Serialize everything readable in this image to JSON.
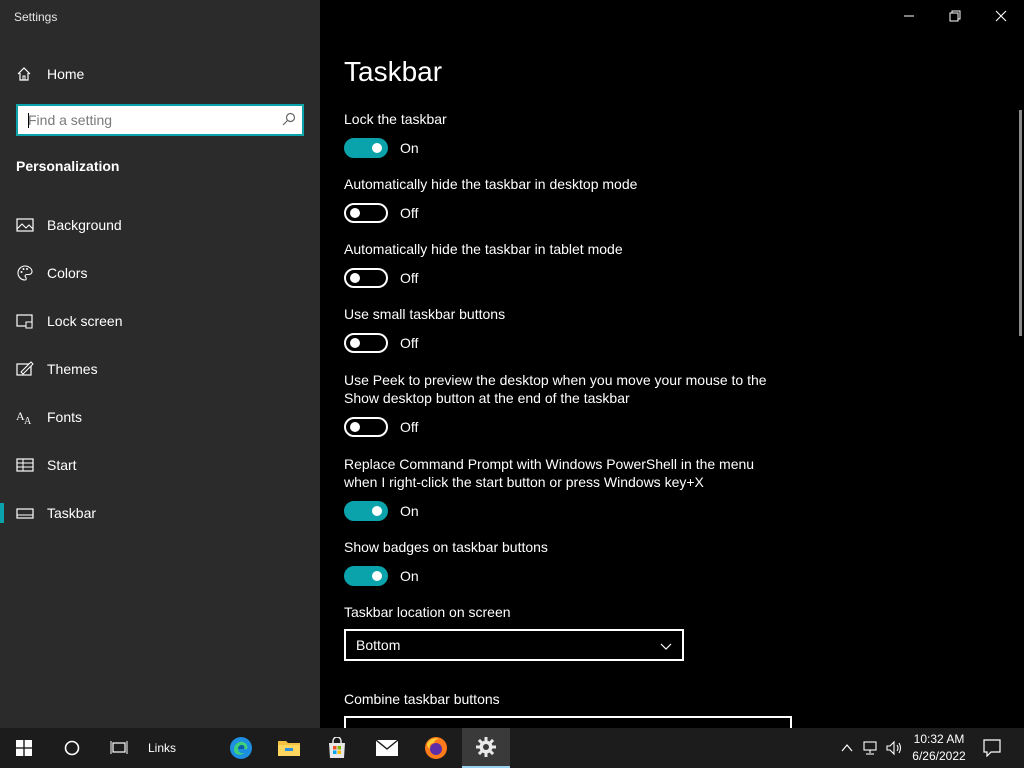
{
  "window": {
    "title": "Settings"
  },
  "sidebar": {
    "home_label": "Home",
    "search_placeholder": "Find a setting",
    "section_title": "Personalization",
    "items": [
      {
        "label": "Background",
        "icon": "image-icon"
      },
      {
        "label": "Colors",
        "icon": "palette-icon"
      },
      {
        "label": "Lock screen",
        "icon": "lock-screen-icon"
      },
      {
        "label": "Themes",
        "icon": "themes-icon"
      },
      {
        "label": "Fonts",
        "icon": "fonts-icon"
      },
      {
        "label": "Start",
        "icon": "start-icon"
      },
      {
        "label": "Taskbar",
        "icon": "taskbar-icon",
        "active": true
      }
    ]
  },
  "page": {
    "title": "Taskbar",
    "settings": [
      {
        "label": "Lock the taskbar",
        "state": "On"
      },
      {
        "label": "Automatically hide the taskbar in desktop mode",
        "state": "Off"
      },
      {
        "label": "Automatically hide the taskbar in tablet mode",
        "state": "Off"
      },
      {
        "label": "Use small taskbar buttons",
        "state": "Off"
      },
      {
        "label_line1": "Use Peek to preview the desktop when you move your mouse to the",
        "label_line2": "Show desktop button at the end of the taskbar",
        "state": "Off"
      },
      {
        "label_line1": "Replace Command Prompt with Windows PowerShell in the menu",
        "label_line2": "when I right-click the start button or press Windows key+X",
        "state": "On"
      },
      {
        "label": "Show badges on taskbar buttons",
        "state": "On"
      }
    ],
    "location_label": "Taskbar location on screen",
    "location_value": "Bottom",
    "combine_label": "Combine taskbar buttons"
  },
  "taskbar": {
    "links_label": "Links",
    "time": "10:32 AM",
    "date": "6/26/2022",
    "icons": [
      "windows-start-icon",
      "cortana-icon",
      "task-view-icon",
      "edge-icon",
      "file-explorer-icon",
      "store-icon",
      "mail-icon",
      "firefox-icon",
      "settings-icon"
    ]
  },
  "colors": {
    "accent": "#0aa3ab",
    "sidebar_bg": "#2b2b2b",
    "content_bg": "#000000",
    "taskbar_bg": "#1c1c1c"
  }
}
